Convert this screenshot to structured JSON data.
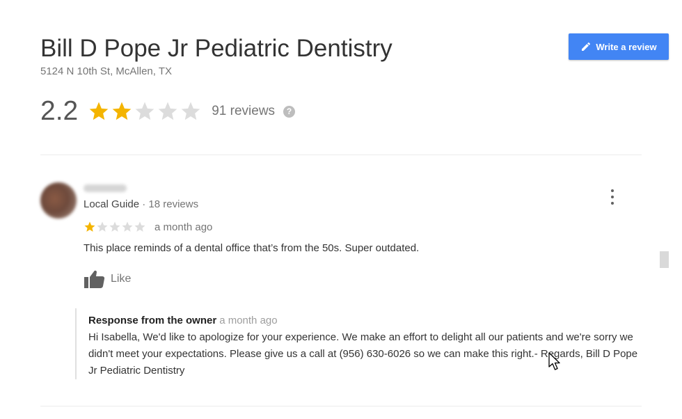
{
  "business": {
    "name": "Bill D Pope Jr Pediatric Dentistry",
    "address": "5124 N 10th St, McAllen, TX",
    "rating_value": "2.2",
    "rating_stars": 2.2,
    "reviews_count": "91 reviews"
  },
  "actions": {
    "write_review_label": "Write a review",
    "write_review_icon": "pencil-icon",
    "help_icon": "?"
  },
  "review": {
    "reviewer_meta_type": "Local Guide",
    "reviewer_meta_count": " · 18 reviews",
    "star_rating": 1,
    "date": "a month ago",
    "text": "This place reminds of a dental office that’s from the 50s. Super outdated.",
    "like_label": "Like",
    "owner_response": {
      "label": "Response from the owner",
      "date": "a month ago",
      "text": "Hi Isabella, We'd like to apologize for your experience. We make an effort to delight all our patients and we're sorry we didn't meet your expectations. Please give us a call at (956) 630-6026 so we can make this right.- Regards, Bill D Pope Jr Pediatric Dentistry"
    }
  },
  "colors": {
    "accent_blue": "#4285f4",
    "star_filled": "#f4b400",
    "star_empty": "#dcdcdc"
  }
}
